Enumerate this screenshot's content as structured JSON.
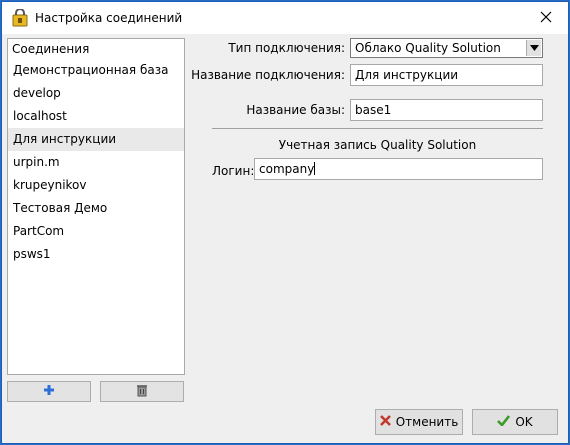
{
  "window": {
    "title": "Настройка соединений"
  },
  "connections": {
    "header": "Соединения",
    "items": [
      {
        "label": "Демонстрационная база",
        "selected": false
      },
      {
        "label": "develop",
        "selected": false
      },
      {
        "label": "localhost",
        "selected": false
      },
      {
        "label": "Для инструкции",
        "selected": true
      },
      {
        "label": "urpin.m",
        "selected": false
      },
      {
        "label": "krupeynikov",
        "selected": false
      },
      {
        "label": "Тестовая Демо",
        "selected": false
      },
      {
        "label": "PartCom",
        "selected": false
      },
      {
        "label": "psws1",
        "selected": false
      }
    ]
  },
  "toolbar": {
    "add_icon": "plus-icon",
    "delete_icon": "trash-icon"
  },
  "form": {
    "type_label": "Тип подключения:",
    "type_value": "Облако Quality Solution",
    "name_label": "Название подключения:",
    "name_value": "Для инструкции",
    "db_label": "Название базы:",
    "db_value": "base1",
    "section_title": "Учетная запись Quality Solution",
    "login_label": "Логин:",
    "login_value": "company"
  },
  "buttons": {
    "cancel_label": "Отменить",
    "ok_label": "OK"
  },
  "colors": {
    "accent_border": "#1c5fb8",
    "ok_check": "#3a9a2a",
    "cancel_x": "#c0392b",
    "add_plus": "#2d6fd6"
  }
}
